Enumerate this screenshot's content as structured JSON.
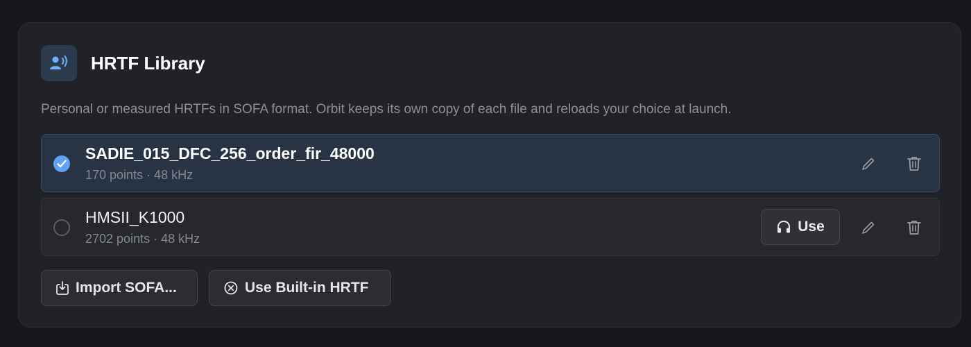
{
  "panel": {
    "title": "HRTF Library",
    "description": "Personal or measured HRTFs in SOFA format. Orbit keeps its own copy of each file and reloads your choice at launch."
  },
  "items": [
    {
      "name": "SADIE_015_DFC_256_order_fir_48000",
      "meta": "170 points · 48 kHz",
      "selected": true
    },
    {
      "name": "HMSII_K1000",
      "meta": "2702 points · 48 kHz",
      "selected": false,
      "use_label": "Use"
    }
  ],
  "actions": {
    "import_label": "Import SOFA...",
    "builtin_label": "Use Built-in HRTF"
  },
  "colors": {
    "accent": "#5fa3f5",
    "card_bg": "#202227",
    "selected_row_bg": "#283344"
  },
  "icons": {
    "header": "speaker-person-icon",
    "selected": "check-circle-icon",
    "edit": "pencil-icon",
    "delete": "trash-icon",
    "use": "headphones-icon",
    "import": "import-icon",
    "builtin": "close-circle-icon"
  }
}
